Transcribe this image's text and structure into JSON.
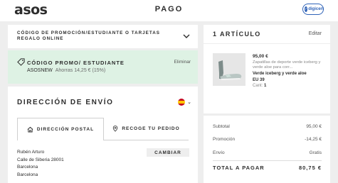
{
  "header": {
    "logo": "asos",
    "title": "PAGO",
    "badge": "digicert"
  },
  "promo_section": {
    "title": "CÓDIGO DE PROMOCIÓN/ESTUDIANTE O TARJETAS REGALO ONLINE",
    "applied_label": "CÓDIGO PROMO/ ESTUDIANTE",
    "applied_code": "ASOSNEW",
    "applied_discount": "Ahorras 14,25 € (15%)",
    "remove_label": "Eliminar",
    "applied_bg": "#def2e4"
  },
  "delivery": {
    "title": "DIRECCIÓN DE ENVÍO",
    "tabs": [
      {
        "label": "DIRECCIÓN POSTAL",
        "icon": "home-icon",
        "active": true
      },
      {
        "label": "RECOGE TU PEDIDO",
        "icon": "location-pin-icon",
        "active": false
      }
    ],
    "address_lines": [
      "Rubén Arturo",
      "Calle de Siberia 28001",
      "Barcelona",
      "Barcelona"
    ],
    "change_label": "CAMBIAR"
  },
  "cart": {
    "title": "1 ARTÍCULO",
    "edit_label": "Editar",
    "item": {
      "price": "95,00 €",
      "description": "Zapatillas de deporte verde iceberg y verde aloe para corr...",
      "variant": "Verde iceberg y verde aloe",
      "size": "EU 39",
      "qty_label": "Cant:",
      "qty": "1"
    }
  },
  "summary": {
    "subtotal_label": "Subtotal",
    "subtotal": "95,00 €",
    "promo_label": "Promoción",
    "promo": "-14,25 €",
    "shipping_label": "Envío",
    "shipping": "Gratis",
    "total_label": "TOTAL A PAGAR",
    "total": "80,75 €"
  }
}
